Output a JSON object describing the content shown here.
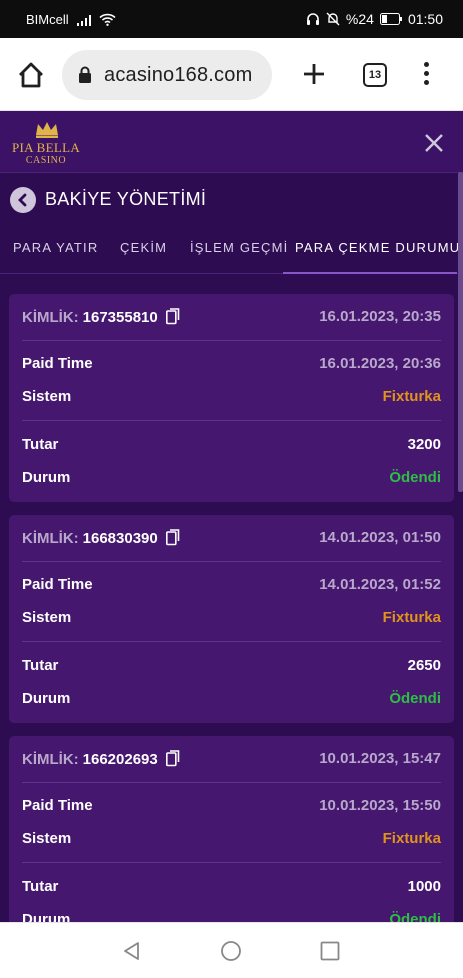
{
  "status_bar": {
    "carrier": "BIMcell",
    "battery": "%24",
    "time": "01:50"
  },
  "browser": {
    "url": "acasino168.com",
    "tab_count": "13",
    "icons": [
      "home-icon",
      "lock-icon",
      "plus-icon",
      "tabs-icon",
      "menu-dots-icon"
    ]
  },
  "site": {
    "logo_brand": "PIA BELLA",
    "logo_sub": "CASINO"
  },
  "page": {
    "title": "BAKİYE YÖNETİMİ",
    "tabs": [
      {
        "label": "PARA YATIR"
      },
      {
        "label": "ÇEKİM"
      },
      {
        "label": "İŞLEM GEÇMİ"
      },
      {
        "label": "PARA ÇEKME DURUMU"
      }
    ],
    "active_tab": "PARA ÇEKME DURUMU"
  },
  "labels": {
    "id": "KİMLİK:",
    "paid_time": "Paid Time",
    "system": "Sistem",
    "amount": "Tutar",
    "status": "Durum"
  },
  "withdrawals": [
    {
      "id": "167355810",
      "date": "16.01.2023, 20:35",
      "paid_time": "16.01.2023, 20:36",
      "system": "Fixturka",
      "amount": "3200",
      "status": "Ödendi"
    },
    {
      "id": "166830390",
      "date": "14.01.2023, 01:50",
      "paid_time": "14.01.2023, 01:52",
      "system": "Fixturka",
      "amount": "2650",
      "status": "Ödendi"
    },
    {
      "id": "166202693",
      "date": "10.01.2023, 15:47",
      "paid_time": "10.01.2023, 15:50",
      "system": "Fixturka",
      "amount": "1000",
      "status": "Ödendi"
    }
  ],
  "colors": {
    "header_bg": "#3b1266",
    "panel_bg": "#2e0c52",
    "card_bg": "#46176e",
    "system_color": "#e0941e",
    "status_color": "#2dbe45"
  }
}
